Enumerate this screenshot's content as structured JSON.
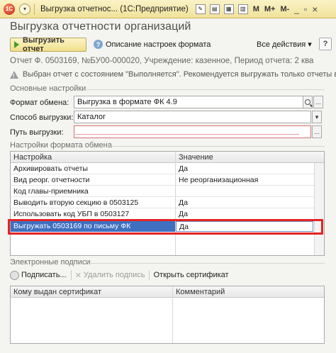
{
  "titlebar": {
    "logo": "1С",
    "title": "Выгрузка отчетнос... (1С:Предприятие)",
    "m_label": "M",
    "mplus_label": "M+",
    "mminus_label": "M-",
    "minimize_glyph": "_",
    "restore_glyph": "▫",
    "close_glyph": "×"
  },
  "form": {
    "title": "Выгрузка отчетности организаций",
    "upload_button": "Выгрузить отчет",
    "format_description": "Описание настроек формата",
    "all_actions": "Все действия ▾",
    "help": "?",
    "report_info": "Отчет Ф. 0503169, №БУ00-000020, Учреждение: казенное, Период отчета: 2 ква",
    "warning": "Выбран отчет с состоянием \"Выполняется\". Рекомендуется выгружать только отчеты в состо"
  },
  "basic_settings": {
    "title": "Основные настройки",
    "exchange_format_label": "Формат обмена:",
    "exchange_format_value": "Выгрузка в формате ФК 4.9",
    "method_label": "Способ выгрузки:",
    "method_value": "Каталог",
    "path_label": "Путь выгрузки:",
    "path_value": ""
  },
  "exchange_settings": {
    "title": "Настройки формата обмена",
    "columns": [
      "Настройка",
      "Значение"
    ],
    "rows": [
      {
        "setting": "Архивировать отчеты",
        "value": "Да"
      },
      {
        "setting": "Вид реорг. отчетности",
        "value": "Не реорганизационная"
      },
      {
        "setting": "Код главы-приемника",
        "value": ""
      },
      {
        "setting": "Выводить вторую секцию в 0503125",
        "value": "Да"
      },
      {
        "setting": "Использовать код УБП в 0503127",
        "value": "Да"
      },
      {
        "setting": "Выгружать 0503169 по письму ФК",
        "value": "Да"
      }
    ]
  },
  "signatures": {
    "title": "Электронные подписи",
    "sign_button": "Подписать...",
    "delete_button": "Удалить подпись",
    "open_cert_button": "Открыть сертификат",
    "columns": [
      "Кому выдан сертификат",
      "Комментарий"
    ]
  }
}
